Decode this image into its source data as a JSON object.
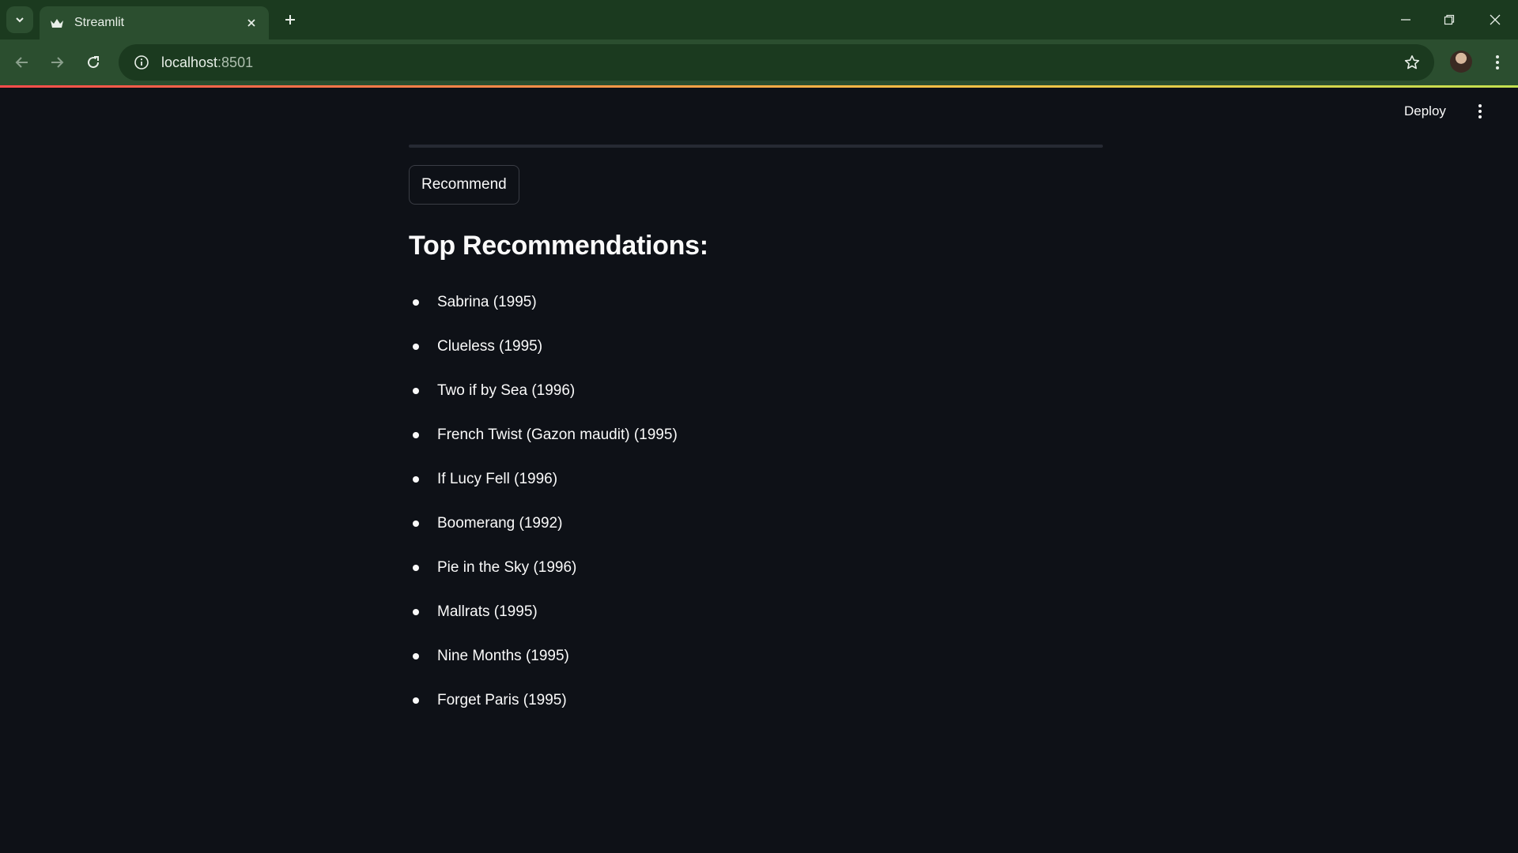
{
  "browser": {
    "tab_title": "Streamlit",
    "url_host": "localhost",
    "url_port": ":8501"
  },
  "app": {
    "deploy_label": "Deploy",
    "recommend_label": "Recommend",
    "section_title": "Top Recommendations:",
    "recommendations": [
      "Sabrina (1995)",
      "Clueless (1995)",
      "Two if by Sea (1996)",
      "French Twist (Gazon maudit) (1995)",
      "If Lucy Fell (1996)",
      "Boomerang (1992)",
      "Pie in the Sky (1996)",
      "Mallrats (1995)",
      "Nine Months (1995)",
      "Forget Paris (1995)"
    ]
  },
  "icons": {
    "tab_search": "chevron-down-icon",
    "favicon": "streamlit-crown-icon",
    "tab_close": "close-icon",
    "new_tab": "plus-icon",
    "minimize": "minimize-icon",
    "restore": "restore-icon",
    "window_close": "close-icon",
    "back": "arrow-left-icon",
    "forward": "arrow-right-icon",
    "reload": "reload-icon",
    "site_info": "info-icon",
    "bookmark": "star-icon",
    "menu": "more-vertical-icon"
  },
  "colors": {
    "app_background": "#0e1117",
    "tabbar": "#1b3a1f",
    "toolbar": "#2b4e2f",
    "text": "#fafafa",
    "accent_red": "#ff4b4b"
  }
}
